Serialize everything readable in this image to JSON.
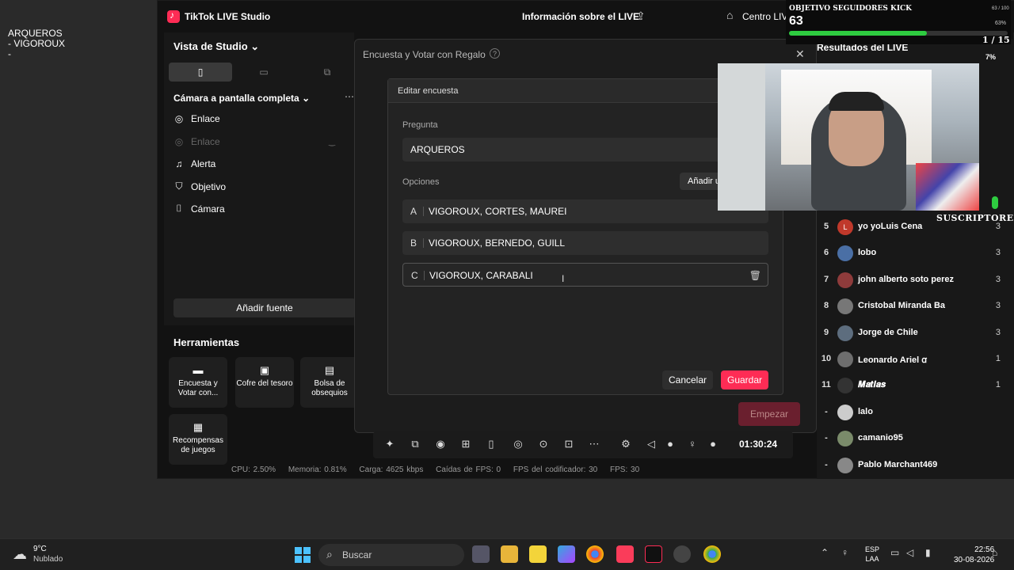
{
  "desktop_note": {
    "text": "ARQUEROS\n- VIGOROUX\n-"
  },
  "app": {
    "title": "TikTok LIVE Studio",
    "info_title": "Información sobre el LIVE",
    "centro": "Centro LIV"
  },
  "left_panel": {
    "title": "Vista de Studio",
    "camera_title": "Cámara a pantalla completa",
    "sources": [
      {
        "label": "Enlace",
        "icon": "globe-icon"
      },
      {
        "label": "Enlace",
        "icon": "globe-icon"
      },
      {
        "label": "Alerta",
        "icon": "bell-icon"
      },
      {
        "label": "Objetivo",
        "icon": "target-icon"
      },
      {
        "label": "Cámara",
        "icon": "camera-icon"
      }
    ],
    "add_source": "Añadir fuente"
  },
  "tools": {
    "title": "Herramientas",
    "items": [
      {
        "label": "Encuesta y Votar con...",
        "icon": "poll-icon"
      },
      {
        "label": "Cofre del tesoro",
        "icon": "chest-icon"
      },
      {
        "label": "Bolsa de obsequios",
        "icon": "gift-bag-icon"
      },
      {
        "label": "Recompensas de juegos",
        "icon": "reward-icon"
      }
    ]
  },
  "outer_modal": {
    "title": "Encuesta y Votar con Regalo",
    "start_button": "Empezar"
  },
  "edit_dialog": {
    "title": "Editar encuesta",
    "question_label": "Pregunta",
    "question_value": "ARQUEROS",
    "options_label": "Opciones",
    "add_option": "Añadir u",
    "options": [
      {
        "letter": "A",
        "text": "VIGOROUX, CORTES, MAUREI"
      },
      {
        "letter": "B",
        "text": "VIGOROUX, BERNEDO, GUILL"
      },
      {
        "letter": "C",
        "text": "VIGOROUX, CARABALI"
      }
    ],
    "cancel": "Cancelar",
    "save": "Guardar"
  },
  "toolbar": {
    "timer": "01:30:24"
  },
  "stats": {
    "cpu": "CPU: 2.50%",
    "memory": "Memoria: 0.81%",
    "load": "Carga: 4625 kbps",
    "fps_drops": "Caídas de FPS: 0",
    "encoder_fps": "FPS del codificador: 30",
    "fps": "FPS: 30"
  },
  "right_panel": {
    "title": "Resultados del LIVE",
    "ranking": [
      {
        "rank": "5",
        "name": "yo yoLuis Cena",
        "score": "3",
        "avatar_letter": "L",
        "avatar_color": "#c0392b"
      },
      {
        "rank": "6",
        "name": "lobo",
        "score": "3",
        "avatar_letter": "",
        "avatar_color": "#4a6fa5"
      },
      {
        "rank": "7",
        "name": "john alberto soto perez",
        "score": "3",
        "avatar_letter": "",
        "avatar_color": "#8e3b3b"
      },
      {
        "rank": "8",
        "name": "Cristobal Miranda Ba",
        "score": "3",
        "avatar_letter": "",
        "avatar_color": "#777777"
      },
      {
        "rank": "9",
        "name": "Jorge de Chile",
        "score": "3",
        "avatar_letter": "",
        "avatar_color": "#5d6d7e"
      },
      {
        "rank": "10",
        "name": "Leonardo Ariel ꭤ",
        "score": "1",
        "avatar_letter": "",
        "avatar_color": "#6e6e6e"
      },
      {
        "rank": "11",
        "name": "𝑴𝒂𝒕𝒊𝒂𝒔",
        "score": "1",
        "avatar_letter": "",
        "avatar_color": "#333333"
      },
      {
        "rank": "-",
        "name": "lalo",
        "score": "",
        "avatar_letter": "",
        "avatar_color": "#cccccc"
      },
      {
        "rank": "-",
        "name": "camanio95",
        "score": "",
        "avatar_letter": "",
        "avatar_color": "#7a8b6a"
      },
      {
        "rank": "-",
        "name": "Pablo Marchant469",
        "score": "",
        "avatar_letter": "",
        "avatar_color": "#888888"
      }
    ]
  },
  "overlay": {
    "goal_title": "OBJETIVO SEGUIDORES KICK",
    "goal_value": "63",
    "goal_small": "63 / 100",
    "goal_pct": "63%",
    "goal_fraction": 0.63,
    "pager": "1 / 15",
    "seven": "7%",
    "subs": "SUSCRIPTORES"
  },
  "taskbar": {
    "temp": "9°C",
    "weather": "Nublado",
    "search": "Buscar",
    "lang_1": "ESP",
    "lang_2": "LAA",
    "time": "22:56",
    "date": "30-08-2026"
  },
  "colors": {
    "accent": "#fe2c55",
    "goal_green": "#2ecc40"
  }
}
